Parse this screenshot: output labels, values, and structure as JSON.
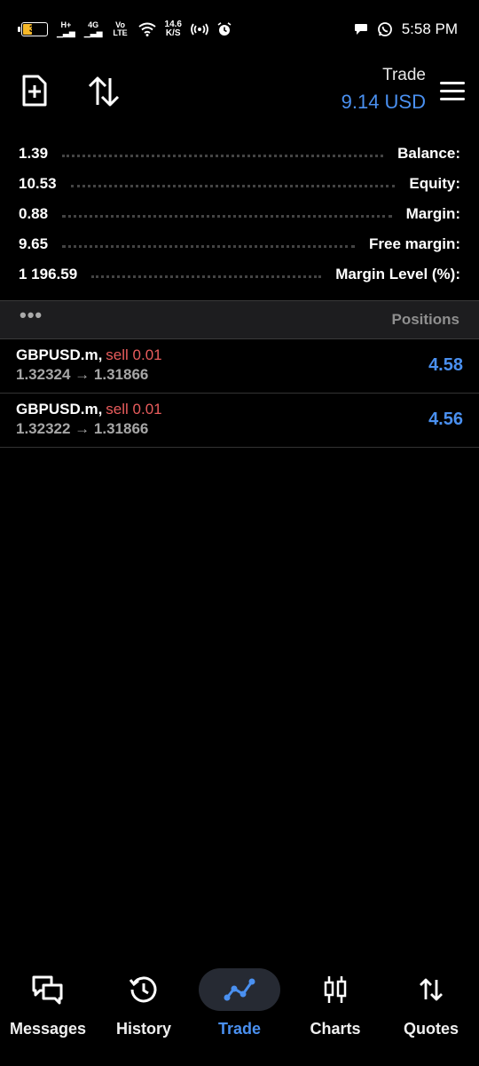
{
  "status_bar": {
    "battery": "39",
    "net_speed_value": "14.6",
    "net_speed_unit": "K/S",
    "network_labels": [
      "H+",
      "4G",
      "Vo LTE"
    ],
    "time": "5:58 PM"
  },
  "header": {
    "title": "Trade",
    "amount": "9.14 USD"
  },
  "summary": [
    {
      "value": "1.39",
      "label": "Balance:"
    },
    {
      "value": "10.53",
      "label": "Equity:"
    },
    {
      "value": "0.88",
      "label": "Margin:"
    },
    {
      "value": "9.65",
      "label": "Free margin:"
    },
    {
      "value": "1 196.59",
      "label": "Margin Level (%):"
    }
  ],
  "positions_section": {
    "more": "•••",
    "title": "Positions"
  },
  "positions": [
    {
      "symbol": "GBPUSD.m,",
      "side": "sell 0.01",
      "prices": "1.32324 → 1.31866",
      "profit": "4.58"
    },
    {
      "symbol": "GBPUSD.m,",
      "side": "sell 0.01",
      "prices": "1.32322 → 1.31866",
      "profit": "4.56"
    }
  ],
  "nav": [
    {
      "label": "Messages",
      "icon": "messages-icon"
    },
    {
      "label": "History",
      "icon": "history-icon"
    },
    {
      "label": "Trade",
      "icon": "trade-icon",
      "active": true
    },
    {
      "label": "Charts",
      "icon": "charts-icon"
    },
    {
      "label": "Quotes",
      "icon": "quotes-icon"
    }
  ],
  "colors": {
    "accent": "#4a90f0",
    "sell": "#e85c5c",
    "background": "#000000"
  }
}
